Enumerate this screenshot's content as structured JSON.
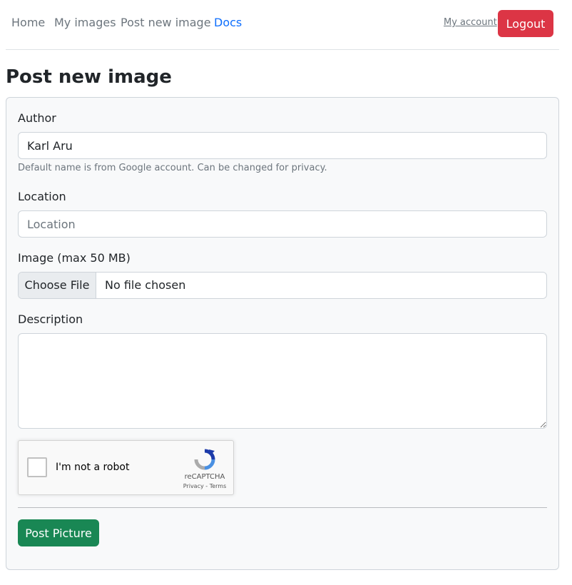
{
  "nav": {
    "items": [
      {
        "label": "Home"
      },
      {
        "label": "My images"
      },
      {
        "label": "Post new image"
      },
      {
        "label": "Docs",
        "active": true
      }
    ],
    "account_label": "My account",
    "logout_label": "Logout"
  },
  "page": {
    "title": "Post new image"
  },
  "form": {
    "author_label": "Author",
    "author_value": "Karl Aru",
    "author_help": "Default name is from Google account. Can be changed for privacy.",
    "location_label": "Location",
    "location_placeholder": "Location",
    "image_label": "Image (max 50 MB)",
    "file_button": "Choose File",
    "file_status": "No file chosen",
    "description_label": "Description",
    "description_value": "",
    "captcha_label": "I'm not a robot",
    "captcha_brand": "reCAPTCHA",
    "captcha_terms": "Privacy - Terms",
    "submit_label": "Post Picture"
  },
  "colors": {
    "link_active": "#0d6efd",
    "logout_bg": "#dc3545",
    "submit_bg": "#198754"
  }
}
